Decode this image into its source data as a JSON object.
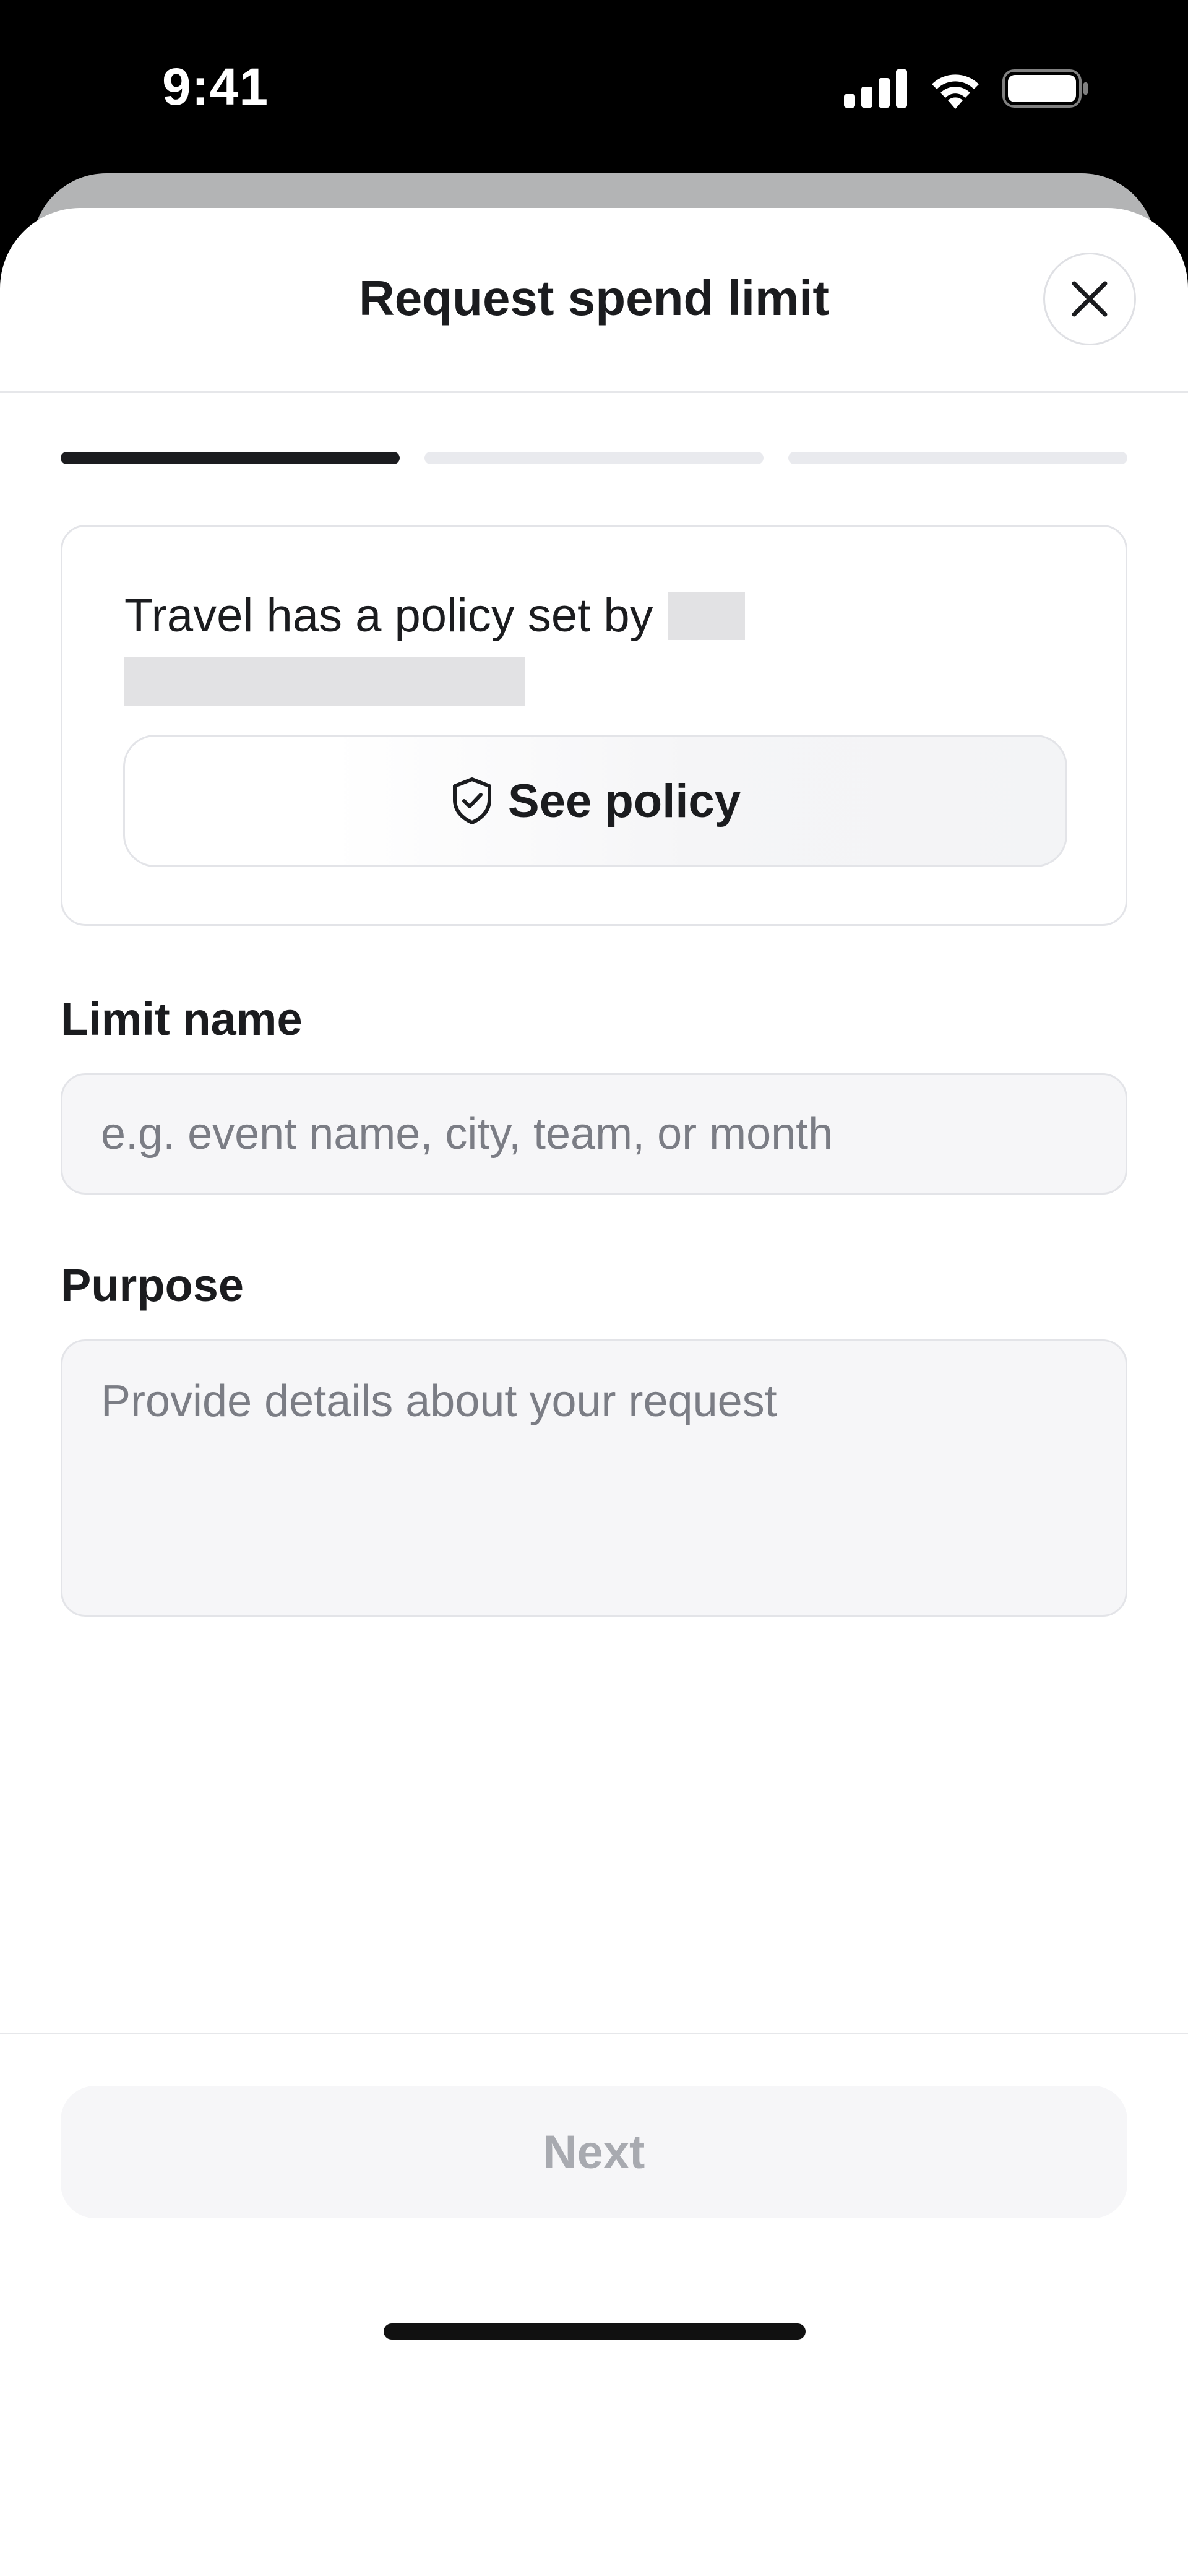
{
  "status_bar": {
    "time": "9:41"
  },
  "sheet": {
    "title": "Request spend limit",
    "close_icon": "close-icon"
  },
  "progress": {
    "total_steps": 3,
    "current_step": 1
  },
  "policy_card": {
    "text": "Travel has a policy set by",
    "button_label": "See policy",
    "button_icon": "shield-check-icon"
  },
  "form": {
    "limit_name": {
      "label": "Limit name",
      "placeholder": "e.g. event name, city, team, or month",
      "value": ""
    },
    "purpose": {
      "label": "Purpose",
      "placeholder": "Provide details about your request",
      "value": ""
    }
  },
  "footer": {
    "next_label": "Next"
  },
  "colors": {
    "text": "#1b1c1f",
    "border": "#e3e4e8",
    "field_bg": "#f6f6f8",
    "disabled_text": "#a8aab0"
  }
}
